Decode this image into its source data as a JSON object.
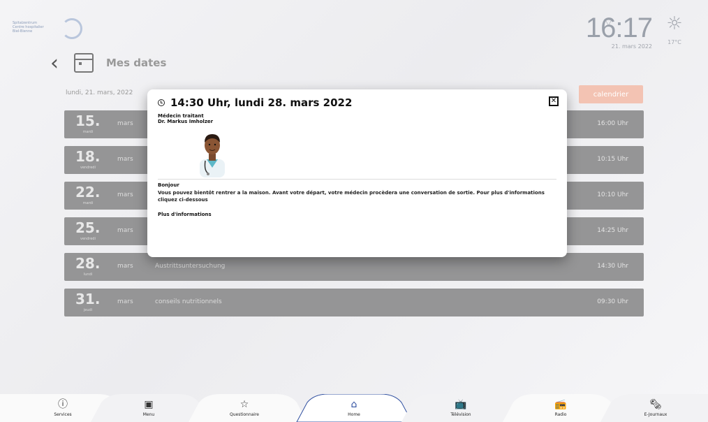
{
  "logo": {
    "line1": "Spitalzentrum",
    "line2": "Centre hospitalier",
    "line3": "Biel-Bienne"
  },
  "status": {
    "time": "16:17",
    "date": "21. mars 2022",
    "temp": "17°C"
  },
  "header": {
    "title": "Mes dates"
  },
  "date_line": "lundi, 21. mars, 2022",
  "calendar_button": "calendrier",
  "appointments": [
    {
      "day": "15.",
      "weekday": "mardi",
      "month": "mars",
      "event": "",
      "time": "16:00 Uhr"
    },
    {
      "day": "18.",
      "weekday": "vendredi",
      "month": "mars",
      "event": "",
      "time": "10:15 Uhr"
    },
    {
      "day": "22.",
      "weekday": "mardi",
      "month": "mars",
      "event": "",
      "time": "10:10 Uhr"
    },
    {
      "day": "25.",
      "weekday": "vendredi",
      "month": "mars",
      "event": "",
      "time": "14:25 Uhr"
    },
    {
      "day": "28.",
      "weekday": "lundi",
      "month": "mars",
      "event": "Austrittsuntersuchung",
      "time": "14:30 Uhr"
    },
    {
      "day": "31.",
      "weekday": "jeudi",
      "month": "mars",
      "event": "conseils nutritionnels",
      "time": "09:30 Uhr"
    }
  ],
  "modal": {
    "title": "14:30 Uhr, lundi 28. mars 2022",
    "role": "Médecin traitant",
    "doctor": "Dr. Markus Imholzer",
    "greeting": "Bonjour",
    "message": "Vous pouvez bientôt rentrer a la maison. Avant votre départ, votre médecin procèdera une conversation de sortie. Pour plus d'informations cliquez ci-dessous",
    "more": "Plus d'informations",
    "close": "✕"
  },
  "nav": [
    {
      "label": "Services",
      "icon": "info-icon",
      "glyph": "ⓘ"
    },
    {
      "label": "Menu",
      "icon": "menu-icon",
      "glyph": "▣"
    },
    {
      "label": "Questionnaire",
      "icon": "questionnaire-icon",
      "glyph": "☆"
    },
    {
      "label": "Home",
      "icon": "home-icon",
      "glyph": "⌂"
    },
    {
      "label": "Télévision",
      "icon": "tv-icon",
      "glyph": "📺"
    },
    {
      "label": "Radio",
      "icon": "radio-icon",
      "glyph": "📻"
    },
    {
      "label": "E-Journaux",
      "icon": "newspaper-icon",
      "glyph": "🗞"
    }
  ],
  "colors": {
    "row_bg": "#959596",
    "accent": "#f3c3b3",
    "nav_active": "#2f4fa0"
  }
}
